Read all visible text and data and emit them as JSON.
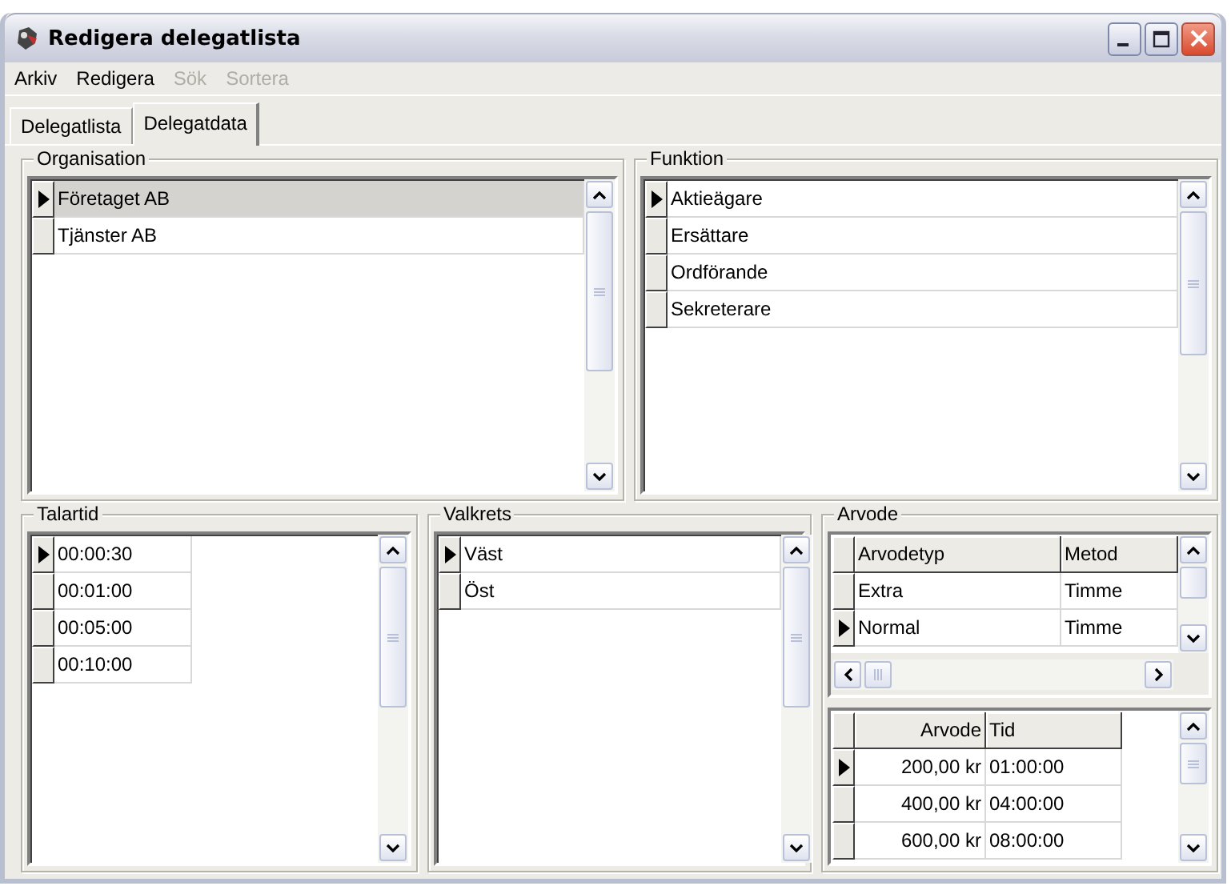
{
  "window": {
    "title": "Redigera delegatlista"
  },
  "menu": [
    {
      "label": "Arkiv",
      "disabled": false
    },
    {
      "label": "Redigera",
      "disabled": false
    },
    {
      "label": "Sök",
      "disabled": true
    },
    {
      "label": "Sortera",
      "disabled": true
    }
  ],
  "tabs": [
    {
      "label": "Delegatlista",
      "selected": false
    },
    {
      "label": "Delegatdata",
      "selected": true
    }
  ],
  "organisation": {
    "title": "Organisation",
    "rows": [
      {
        "text": "Företaget AB",
        "selected": true,
        "highlighted": true
      },
      {
        "text": "Tjänster AB",
        "selected": false,
        "highlighted": false
      }
    ]
  },
  "funktion": {
    "title": "Funktion",
    "rows": [
      {
        "text": "Aktieägare",
        "selected": true
      },
      {
        "text": "Ersättare",
        "selected": false
      },
      {
        "text": "Ordförande",
        "selected": false
      },
      {
        "text": "Sekreterare",
        "selected": false
      }
    ]
  },
  "talartid": {
    "title": "Talartid",
    "rows": [
      {
        "text": "00:00:30",
        "selected": true
      },
      {
        "text": "00:01:00",
        "selected": false
      },
      {
        "text": "00:05:00",
        "selected": false
      },
      {
        "text": "00:10:00",
        "selected": false
      }
    ]
  },
  "valkrets": {
    "title": "Valkrets",
    "rows": [
      {
        "text": "Väst",
        "selected": true
      },
      {
        "text": "Öst",
        "selected": false
      }
    ]
  },
  "arvode": {
    "title": "Arvode",
    "types": {
      "columns": [
        "Arvodetyp",
        "Metod"
      ],
      "rows": [
        {
          "cells": [
            "Extra",
            "Timme"
          ],
          "selected": false
        },
        {
          "cells": [
            "Normal",
            "Timme"
          ],
          "selected": true
        }
      ]
    },
    "fees": {
      "columns": [
        "Arvode",
        "Tid"
      ],
      "rows": [
        {
          "cells": [
            "200,00 kr",
            "01:00:00"
          ],
          "selected": true
        },
        {
          "cells": [
            "400,00 kr",
            "04:00:00"
          ],
          "selected": false
        },
        {
          "cells": [
            "600,00 kr",
            "08:00:00"
          ],
          "selected": false
        }
      ]
    }
  }
}
